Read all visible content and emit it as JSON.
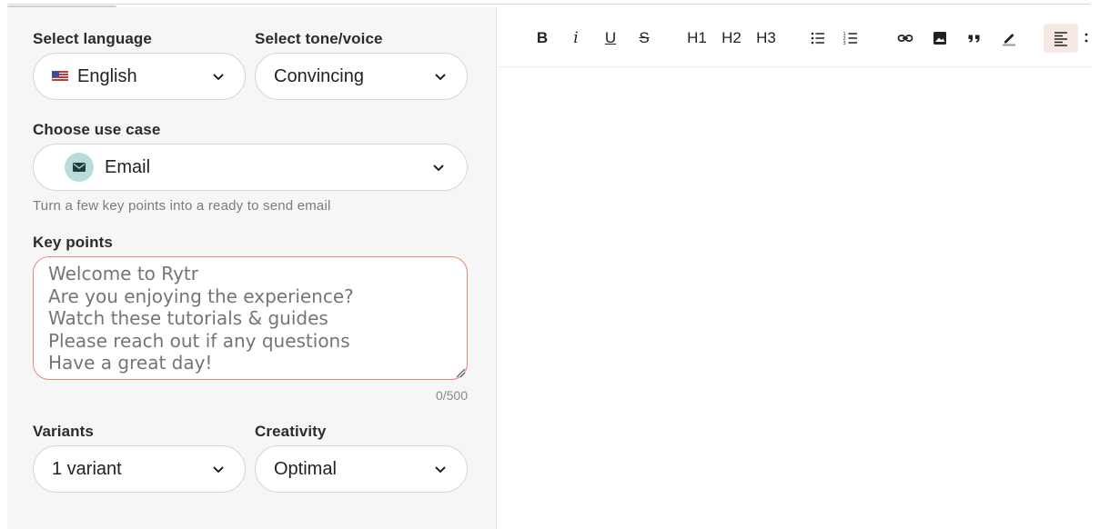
{
  "left": {
    "language": {
      "label": "Select language",
      "value": "English"
    },
    "tone": {
      "label": "Select tone/voice",
      "value": "Convincing"
    },
    "use_case": {
      "label": "Choose use case",
      "value": "Email",
      "hint": "Turn a few key points into a ready to send email"
    },
    "key_points": {
      "label": "Key points",
      "placeholder": "Welcome to Rytr\nAre you enjoying the experience?\nWatch these tutorials & guides\nPlease reach out if any questions\nHave a great day!",
      "counter": "0/500"
    },
    "variants": {
      "label": "Variants",
      "value": "1 variant"
    },
    "creativity": {
      "label": "Creativity",
      "value": "Optimal"
    }
  },
  "toolbar": {
    "bold": "B",
    "italic": "i",
    "underline": "U",
    "strike": "S",
    "h1": "H1",
    "h2": "H2",
    "h3": "H3"
  },
  "colors": {
    "accent_border": "#e28a79",
    "active_button_bg": "#f8e8e3",
    "mail_badge": "#b8dcd8"
  }
}
